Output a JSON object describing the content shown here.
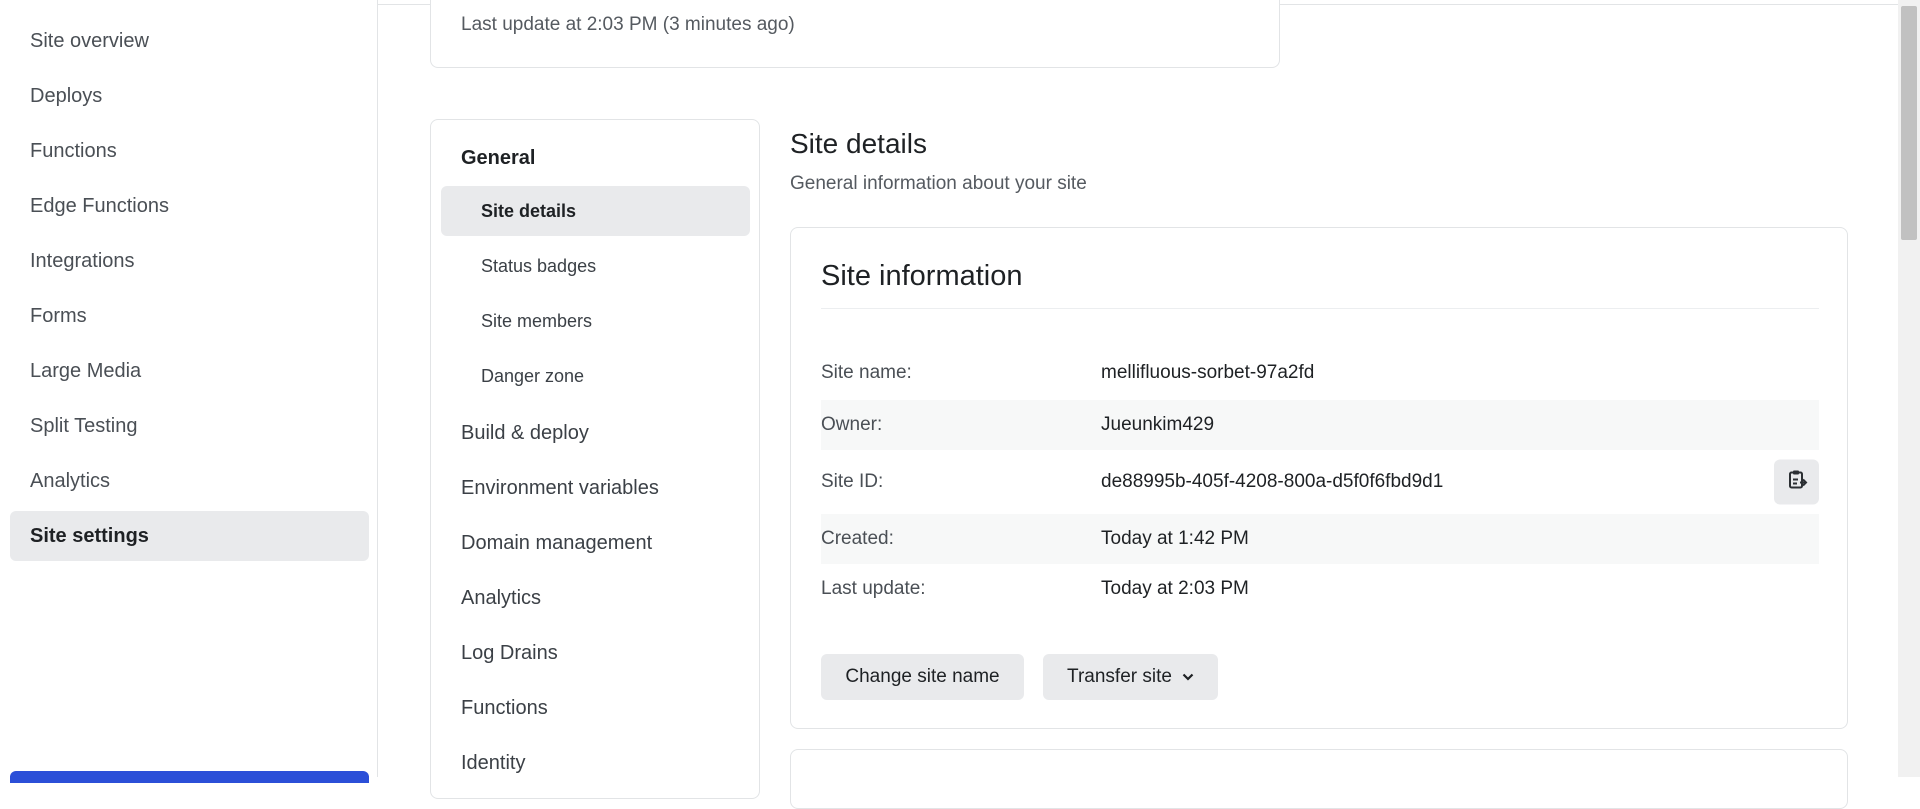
{
  "sidebar": {
    "items": [
      {
        "label": "Site overview"
      },
      {
        "label": "Deploys"
      },
      {
        "label": "Functions"
      },
      {
        "label": "Edge Functions"
      },
      {
        "label": "Integrations"
      },
      {
        "label": "Forms"
      },
      {
        "label": "Large Media"
      },
      {
        "label": "Split Testing"
      },
      {
        "label": "Analytics"
      },
      {
        "label": "Site settings"
      }
    ],
    "active": "Site settings"
  },
  "status": {
    "text": "Last update at 2:03 PM (3 minutes ago)"
  },
  "settings_nav": {
    "general": "General",
    "general_items": [
      {
        "label": "Site details"
      },
      {
        "label": "Status badges"
      },
      {
        "label": "Site members"
      },
      {
        "label": "Danger zone"
      }
    ],
    "sections": [
      {
        "label": "Build & deploy"
      },
      {
        "label": "Environment variables"
      },
      {
        "label": "Domain management"
      },
      {
        "label": "Analytics"
      },
      {
        "label": "Log Drains"
      },
      {
        "label": "Functions"
      },
      {
        "label": "Identity"
      }
    ]
  },
  "main": {
    "title": "Site details",
    "subtitle": "General information about your site",
    "card": {
      "title": "Site information",
      "rows": [
        {
          "label": "Site name:",
          "value": "mellifluous-sorbet-97a2fd"
        },
        {
          "label": "Owner:",
          "value": "Jueunkim429"
        },
        {
          "label": "Site ID:",
          "value": "de88995b-405f-4208-800a-d5f0f6fbd9d1"
        },
        {
          "label": "Created:",
          "value": "Today at 1:42 PM"
        },
        {
          "label": "Last update:",
          "value": "Today at 2:03 PM"
        }
      ],
      "change_name_label": "Change site name",
      "transfer_label": "Transfer site"
    }
  },
  "icons": {
    "copy": "clipboard-copy-icon",
    "chevron": "chevron-down-icon"
  },
  "colors": {
    "accent": "#2b4fd8",
    "active_bg": "#e9eaec"
  }
}
